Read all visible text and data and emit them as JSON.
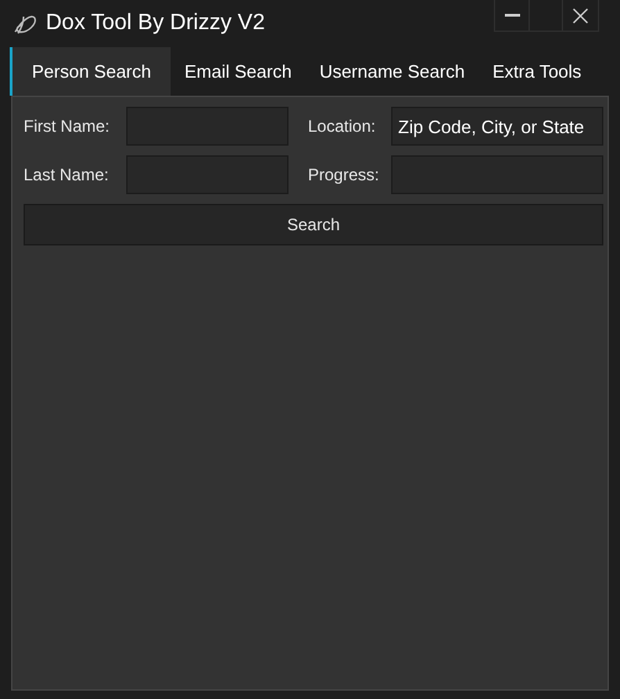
{
  "window": {
    "title": "Dox Tool By Drizzy V2"
  },
  "tabs": [
    {
      "label": "Person Search",
      "selected": true
    },
    {
      "label": "Email Search",
      "selected": false
    },
    {
      "label": "Username Search",
      "selected": false
    },
    {
      "label": "Extra Tools",
      "selected": false
    }
  ],
  "form": {
    "fields": [
      {
        "label": "First Name:"
      },
      {
        "label": "Location:",
        "value": "Zip Code, City, or State"
      },
      {
        "label": "Last Name:"
      },
      {
        "label": "Progress:"
      }
    ],
    "button": "Search"
  }
}
